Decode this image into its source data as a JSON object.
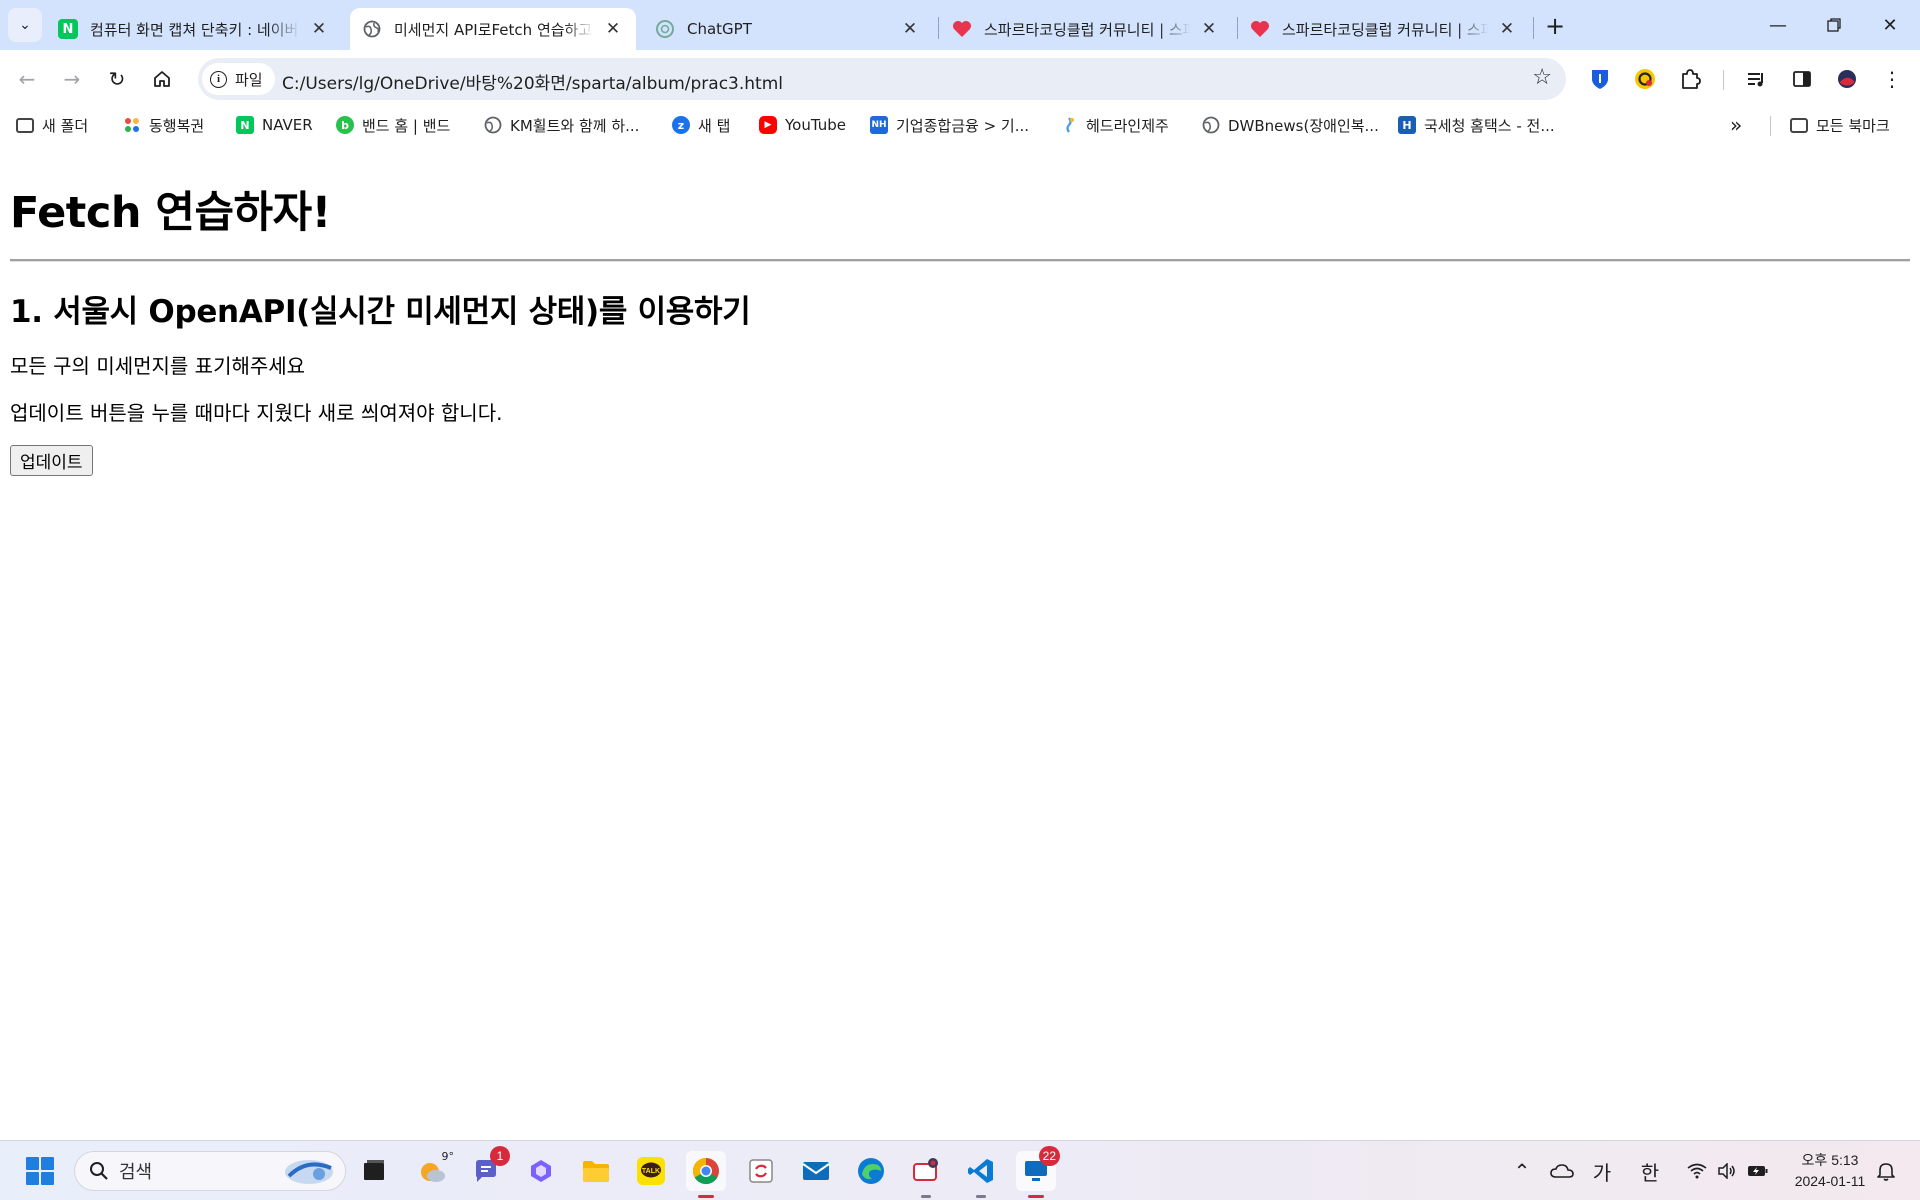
{
  "browser": {
    "tabs": [
      {
        "title": "컴퓨터 화면 캡쳐 단축키 : 네이버",
        "favicon_letter": "N",
        "favicon_color": "#03c75a",
        "active": false
      },
      {
        "title": "미세먼지 API로Fetch 연습하고",
        "favicon_letter": "",
        "favicon_color": "#5f6368",
        "active": true
      },
      {
        "title": "ChatGPT",
        "favicon_letter": "",
        "favicon_color": "#74aa9c",
        "active": false
      },
      {
        "title": "스파르타코딩클럽 커뮤니티 | 스파르타",
        "favicon_letter": "",
        "favicon_color": "#e8344e",
        "active": false
      },
      {
        "title": "스파르타코딩클럽 커뮤니티 | 스파르타",
        "favicon_letter": "",
        "favicon_color": "#e8344e",
        "active": false
      }
    ],
    "new_tab_label": "+",
    "close_glyph": "✕",
    "address": {
      "chip_label": "파일",
      "url": "C:/Users/lg/OneDrive/바탕%20화면/sparta/album/prac3.html"
    },
    "bookmarks": [
      {
        "label": "새 폴더",
        "icon": "folder-icon",
        "color": "#444444"
      },
      {
        "label": "동행복권",
        "icon": "dhlottery-icon",
        "color": "#e94b3c"
      },
      {
        "label": "NAVER",
        "icon": "naver-icon",
        "color": "#03c75a",
        "letter": "N"
      },
      {
        "label": "밴드 홈 | 밴드",
        "icon": "band-icon",
        "color": "#27c24c",
        "letter": "b"
      },
      {
        "label": "KM휠트와 함께 하...",
        "icon": "globe-icon",
        "color": "#5f6368"
      },
      {
        "label": "새 탭",
        "icon": "newtab-icon",
        "color": "#1a73e8",
        "letter": "z"
      },
      {
        "label": "YouTube",
        "icon": "youtube-icon",
        "color": "#ff0000",
        "letter": "▶"
      },
      {
        "label": "기업종합금융 > 기...",
        "icon": "nh-icon",
        "color": "#1e6bd6",
        "letter": "NH"
      },
      {
        "label": "헤드라인제주",
        "icon": "headline-icon",
        "color": "#4a9be0"
      },
      {
        "label": "DWBnews(장애인복...",
        "icon": "globe-icon",
        "color": "#5f6368"
      },
      {
        "label": "국세청 홈택스 - 전...",
        "icon": "hometax-icon",
        "color": "#1a5fb4",
        "letter": "H"
      }
    ],
    "all_bookmarks_label": "모든 북마크",
    "overflow_glyph": "»"
  },
  "page": {
    "h1": "Fetch 연습하자!",
    "h2": "1. 서울시 OpenAPI(실시간 미세먼지 상태)를 이용하기",
    "p1": "모든 구의 미세먼지를 표기해주세요",
    "p2": "업데이트 버튼을 누를 때마다 지웠다 새로 씌여져야 합니다.",
    "button": "업데이트"
  },
  "taskbar": {
    "search_placeholder": "검색",
    "weather_temp": "9°",
    "teams_badge": "1",
    "mail_badge": "22",
    "ime_ga": "가",
    "ime_han": "한",
    "clock_time": "오후 5:13",
    "clock_date": "2024-01-11"
  },
  "colors": {
    "tabstrip_bg": "#d3e3fd",
    "omnibox_bg": "#e9eef6",
    "windows_blue": "#1f7fe0",
    "badge_red": "#d62b3c"
  }
}
